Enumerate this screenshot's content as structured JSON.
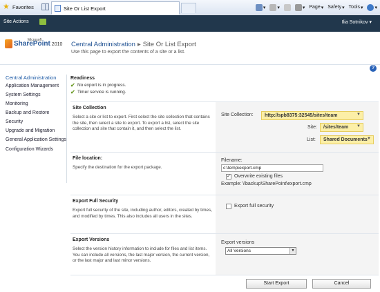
{
  "browser": {
    "favorites": "Favorites",
    "tab_title": "Site Or List Export",
    "page_menu": "Page",
    "safety_menu": "Safety",
    "tools_menu": "Tools"
  },
  "topbar": {
    "site_actions": "Site Actions",
    "user": "Ilia Sotnikov"
  },
  "title": {
    "logo_small": "Microsoft",
    "logo": "SharePoint",
    "logo_year": "2010",
    "breadcrumb_root": "Central Administration",
    "breadcrumb_sep": "▸",
    "breadcrumb_current": "Site Or List Export",
    "description": "Use this page to export the contents of a site or a list."
  },
  "nav": {
    "items": [
      "Central Administration",
      "Application Management",
      "System Settings",
      "Monitoring",
      "Backup and Restore",
      "Security",
      "Upgrade and Migration",
      "General Application Settings",
      "Configuration Wizards"
    ]
  },
  "readiness": {
    "title": "Readiness",
    "items": [
      "No export is in progress.",
      "Timer service is running."
    ]
  },
  "site_collection": {
    "title": "Site Collection",
    "desc": "Select a site or list to export.  First select the site collection that contains the site, then select a site to export. To export a list, select the site collection and site that contain it, and then select the list.",
    "collection_label": "Site Collection:",
    "collection_value": "http://spb8375:32545/sites/team",
    "site_label": "Site:",
    "site_value": "/sites/team",
    "list_label": "List:",
    "list_value": "Shared Documents"
  },
  "file_location": {
    "title": "File location:",
    "desc": "Specify the destination for the export package.",
    "filename_label": "Filename:",
    "filename_value": "c:\\temp\\export.cmp",
    "overwrite_label": "Overwrite existing files",
    "overwrite_checked": true,
    "example": "Example: \\\\backup\\SharePoint\\export.cmp"
  },
  "security": {
    "title": "Export Full Security",
    "desc": "Export full security of the site, including author, editors, created by times, and modified by times. This also includes all users in the sites.",
    "checkbox_label": "Export full security",
    "checked": false
  },
  "versions": {
    "title": "Export Versions",
    "desc": "Select the version history information to include for files and list items. You can include all versions, the last major version, the current version, or the last major and last minor versions.",
    "label": "Export versions",
    "selected": "All Versions"
  },
  "buttons": {
    "start": "Start Export",
    "cancel": "Cancel"
  },
  "colors": {
    "ribbon": "#21374c",
    "dropdown_bg": "#fcefa7",
    "link": "#1d5aa6"
  }
}
